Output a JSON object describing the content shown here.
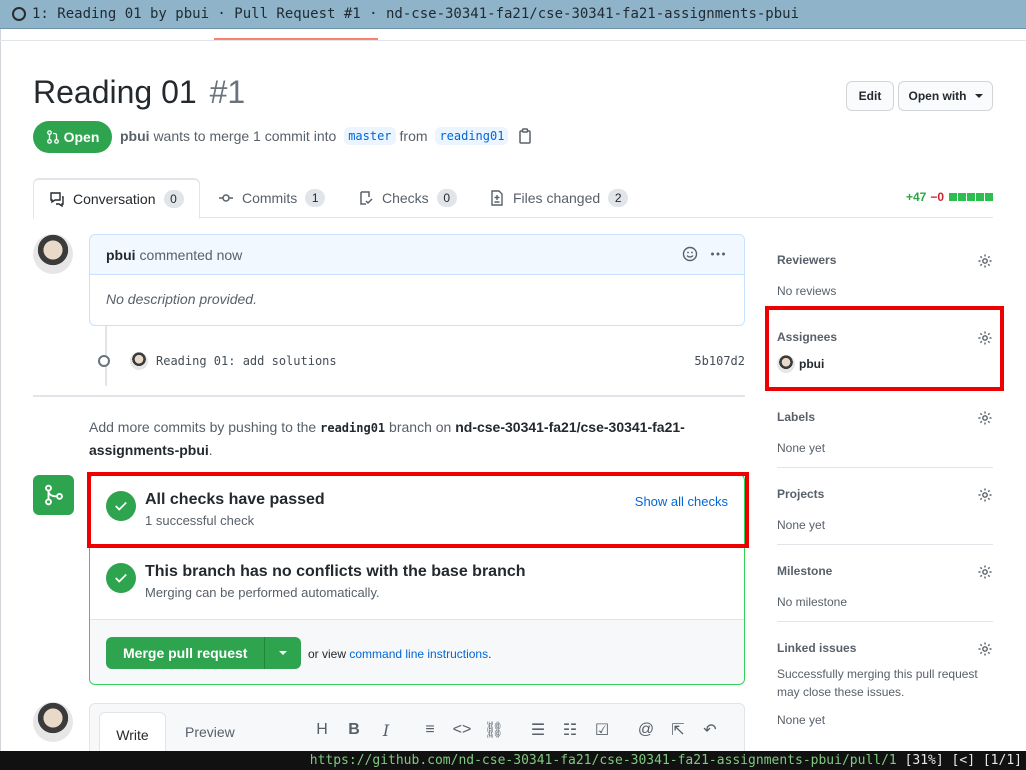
{
  "window": {
    "title": "1: Reading 01 by pbui · Pull Request #1 · nd-cse-30341-fa21/cse-30341-fa21-assignments-pbui"
  },
  "header": {
    "title": "Reading 01",
    "number": "#1",
    "edit_label": "Edit",
    "open_with_label": "Open with",
    "state_label": "Open",
    "author": "pbui",
    "merge_text": "wants to merge 1 commit into",
    "base_branch": "master",
    "from_text": "from",
    "head_branch": "reading01"
  },
  "tabs": [
    {
      "label": "Conversation",
      "count": "0"
    },
    {
      "label": "Commits",
      "count": "1"
    },
    {
      "label": "Checks",
      "count": "0"
    },
    {
      "label": "Files changed",
      "count": "2"
    }
  ],
  "diffstat": {
    "additions": "+47",
    "deletions": "−0"
  },
  "comment": {
    "author": "pbui",
    "time_text": "commented now",
    "body": "No description provided."
  },
  "commit": {
    "message": "Reading 01: add solutions",
    "sha": "5b107d2"
  },
  "push_note": {
    "prefix": "Add more commits by pushing to the",
    "branch": "reading01",
    "middle": "branch on",
    "repo": "nd-cse-30341-fa21/cse-30341-fa21-assignments-pbui",
    "suffix": "."
  },
  "merge": {
    "checks_title": "All checks have passed",
    "checks_sub": "1 successful check",
    "show_all_checks": "Show all checks",
    "conflicts_title": "This branch has no conflicts with the base branch",
    "conflicts_sub": "Merging can be performed automatically.",
    "merge_button": "Merge pull request",
    "or_view": "or view",
    "cli_link": "command line instructions",
    "period": "."
  },
  "write": {
    "write_tab": "Write",
    "preview_tab": "Preview"
  },
  "sidebar": {
    "reviewers": {
      "title": "Reviewers",
      "value": "No reviews"
    },
    "assignees": {
      "title": "Assignees",
      "value": "pbui"
    },
    "labels": {
      "title": "Labels",
      "value": "None yet"
    },
    "projects": {
      "title": "Projects",
      "value": "None yet"
    },
    "milestone": {
      "title": "Milestone",
      "value": "No milestone"
    },
    "linked_issues": {
      "title": "Linked issues",
      "description": "Successfully merging this pull request may close these issues.",
      "value": "None yet"
    }
  },
  "statusbar": {
    "url": "https://github.com/nd-cse-30341-fa21/cse-30341-fa21-assignments-pbui/pull/1",
    "percent": "[31%]",
    "back": "[<]",
    "page": "[1/1]"
  },
  "colors": {
    "green": "#2ea44f",
    "blue_link": "#0366d6",
    "highlight_red": "#ee0000"
  }
}
